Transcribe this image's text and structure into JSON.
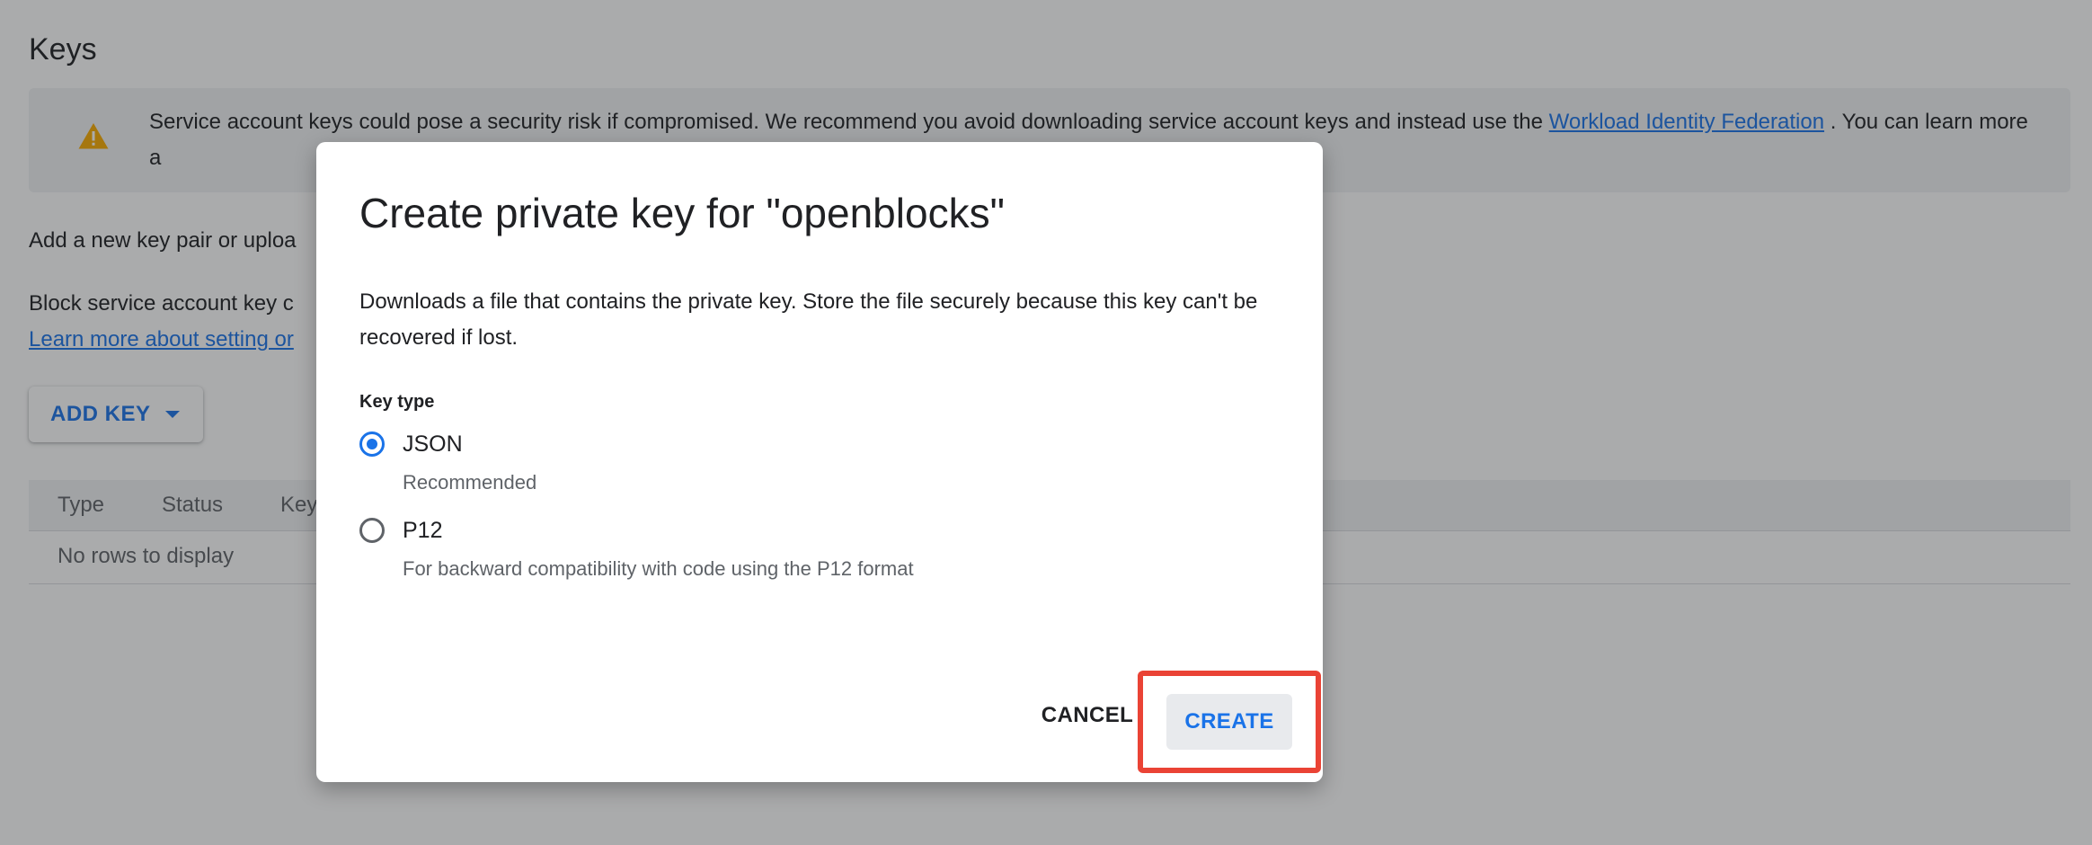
{
  "page": {
    "title": "Keys",
    "banner": {
      "text_before": "Service account keys could pose a security risk if compromised. We recommend you avoid downloading service account keys and instead use the ",
      "link": "Workload Identity Federation",
      "text_after": " . You can learn more a"
    },
    "add_text": "Add a new key pair or uploa",
    "block_text": "Block service account key c",
    "learn_more_link": "Learn more about setting or",
    "add_key_label": "ADD KEY",
    "table": {
      "columns": [
        "Type",
        "Status",
        "Key"
      ],
      "empty": "No rows to display"
    }
  },
  "dialog": {
    "title": "Create private key for \"openblocks\"",
    "description": "Downloads a file that contains the private key. Store the file securely because this key can't be recovered if lost.",
    "key_type_label": "Key type",
    "options": [
      {
        "label": "JSON",
        "hint": "Recommended",
        "checked": true
      },
      {
        "label": "P12",
        "hint": "For backward compatibility with code using the P12 format",
        "checked": false
      }
    ],
    "cancel_label": "CANCEL",
    "create_label": "CREATE"
  },
  "colors": {
    "accent": "#1a73e8",
    "warning": "#f9ab00",
    "highlight": "#ea4335"
  },
  "icons": {
    "warning": "warning-icon",
    "dropdown": "caret-down-icon"
  }
}
